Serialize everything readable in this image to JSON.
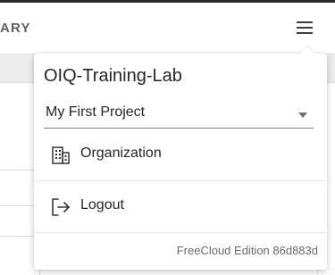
{
  "header": {
    "title_fragment": "ARY"
  },
  "account_menu": {
    "organization_name": "OIQ-Training-Lab",
    "project_select": {
      "selected": "My First Project"
    },
    "items": [
      {
        "label": "Organization",
        "icon": "building-icon"
      },
      {
        "label": "Logout",
        "icon": "logout-icon"
      }
    ],
    "edition": "FreeCloud Edition 86d883d"
  },
  "colors": {
    "text": "#262626",
    "muted_text": "#6b6b6b",
    "header_bar": "#2a2a2a"
  }
}
